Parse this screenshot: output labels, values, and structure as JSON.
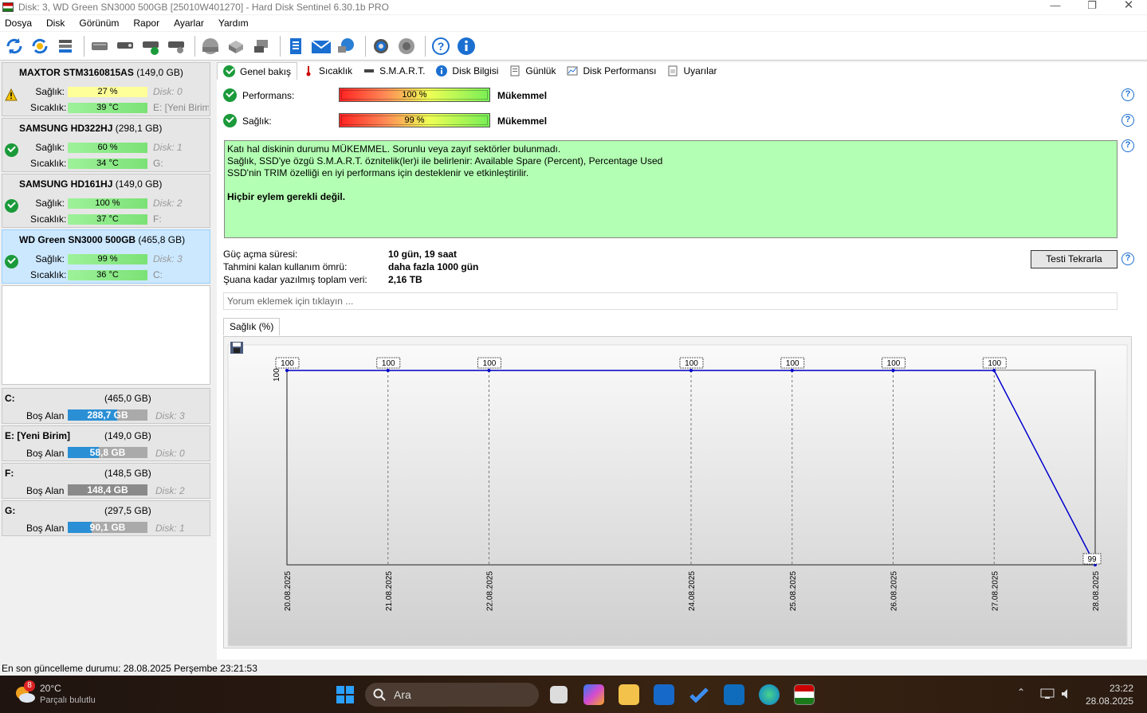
{
  "window": {
    "title": "Disk: 3, WD Green SN3000 500GB [25010W401270]  -  Hard Disk Sentinel 6.30.1b PRO"
  },
  "menu": [
    "Dosya",
    "Disk",
    "Görünüm",
    "Rapor",
    "Ayarlar",
    "Yardım"
  ],
  "toolbar": [
    "refresh-icon",
    "refresh-all-icon",
    "disk-list-icon",
    "disk-icon",
    "disk-test-icon",
    "disk-ok-icon",
    "disk-settings-icon",
    "disk-gray-icon",
    "tape-icon",
    "drive-network-icon",
    "report-icon",
    "mail-icon",
    "network-icon",
    "gear-icon",
    "sound-icon",
    "help-icon",
    "info-icon"
  ],
  "disks": [
    {
      "name": "MAXTOR STM3160815AS",
      "size": "(149,0 GB)",
      "health_label": "Sağlık:",
      "health": "27 %",
      "health_frac": 0.27,
      "temp_label": "Sıcaklık:",
      "temp": "39 °C",
      "disk": "Disk: 0",
      "vol": "E: [Yeni Birim]",
      "status": "warning"
    },
    {
      "name": "SAMSUNG HD322HJ",
      "size": "(298,1 GB)",
      "health_label": "Sağlık:",
      "health": "60 %",
      "health_frac": 0.6,
      "temp_label": "Sıcaklık:",
      "temp": "34 °C",
      "disk": "Disk: 1",
      "vol": "G:",
      "status": "ok"
    },
    {
      "name": "SAMSUNG HD161HJ",
      "size": "(149,0 GB)",
      "health_label": "Sağlık:",
      "health": "100 %",
      "health_frac": 1.0,
      "temp_label": "Sıcaklık:",
      "temp": "37 °C",
      "disk": "Disk: 2",
      "vol": "F:",
      "status": "ok"
    },
    {
      "name": "WD Green SN3000 500GB",
      "size": "(465,8 GB)",
      "health_label": "Sağlık:",
      "health": "99 %",
      "health_frac": 0.99,
      "temp_label": "Sıcaklık:",
      "temp": "36 °C",
      "disk": "Disk: 3",
      "vol": "C:",
      "status": "ok"
    }
  ],
  "volumes": [
    {
      "name": "C:",
      "size": "(465,0 GB)",
      "free_label": "Boş Alan",
      "free": "288,7 GB",
      "free_frac": 0.62,
      "disk": "Disk: 3",
      "bar_color": "#2b8fd5"
    },
    {
      "name": "E: [Yeni Birim]",
      "size": "(149,0 GB)",
      "free_label": "Boş Alan",
      "free": "58,8 GB",
      "free_frac": 0.39,
      "disk": "Disk: 0",
      "bar_color": "#2b8fd5"
    },
    {
      "name": "F:",
      "size": "(148,5 GB)",
      "free_label": "Boş Alan",
      "free": "148,4 GB",
      "free_frac": 1.0,
      "disk": "Disk: 2",
      "bar_color": "#8a8a8a"
    },
    {
      "name": "G:",
      "size": "(297,5 GB)",
      "free_label": "Boş Alan",
      "free": "90,1 GB",
      "free_frac": 0.3,
      "disk": "Disk: 1",
      "bar_color": "#2b8fd5"
    }
  ],
  "tabs": [
    "Genel bakış",
    "Sıcaklık",
    "S.M.A.R.T.",
    "Disk Bilgisi",
    "Günlük",
    "Disk Performansı",
    "Uyarılar"
  ],
  "overview": {
    "perf_label": "Performans:",
    "perf_value": "100 %",
    "perf_rating": "Mükemmel",
    "health_label": "Sağlık:",
    "health_value": "99 %",
    "health_rating": "Mükemmel",
    "info_lines": [
      "Katı hal diskinin durumu MÜKEMMEL. Sorunlu veya zayıf sektörler bulunmadı.",
      "Sağlık, SSD'ye özgü S.M.A.R.T. öznitelik(ler)i ile belirlenir:  Available Spare (Percent), Percentage Used",
      "SSD'nin TRIM özelliği en iyi performans için desteklenir ve etkinleştirilir."
    ],
    "action": "Hiçbir eylem gerekli değil.",
    "power_on_label": "Güç açma süresi:",
    "power_on": "10 gün, 19 saat",
    "remaining_label": "Tahmini kalan kullanım ömrü:",
    "remaining": "daha fazla 1000 gün",
    "written_label": "Şuana kadar yazılmış toplam veri:",
    "written": "2,16 TB",
    "retest": "Testi Tekrarla",
    "comment_placeholder": "Yorum eklemek için tıklayın ..."
  },
  "chart_tab": "Sağlık (%)",
  "chart_data": {
    "type": "line",
    "x": [
      "20.08.2025",
      "21.08.2025",
      "22.08.2025",
      "24.08.2025",
      "25.08.2025",
      "26.08.2025",
      "27.08.2025",
      "28.08.2025"
    ],
    "x_index": [
      0,
      1,
      2,
      4,
      5,
      6,
      7,
      8
    ],
    "values": [
      100,
      100,
      100,
      100,
      100,
      100,
      100,
      99
    ],
    "ylabel": "100",
    "ylim": [
      99,
      100
    ],
    "color": "#0000cc"
  },
  "status_text": "En son güncelleme durumu: 28.08.2025 Perşembe 23:21:53",
  "taskbar": {
    "temp": "20°C",
    "weather": "Parçalı bulutlu",
    "badge": "8",
    "search": "Ara",
    "time": "23:22",
    "date": "28.08.2025"
  }
}
